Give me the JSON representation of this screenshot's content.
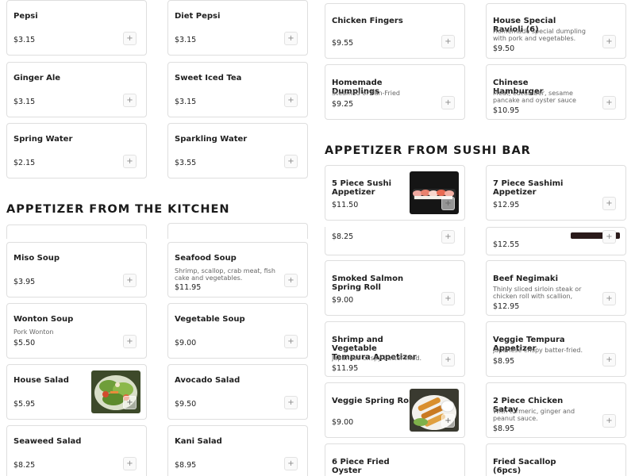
{
  "left": {
    "drinks": [
      {
        "name": "Pepsi",
        "price": "$3.15"
      },
      {
        "name": "Diet Pepsi",
        "price": "$3.15"
      },
      {
        "name": "Ginger Ale",
        "price": "$3.15"
      },
      {
        "name": "Sweet Iced Tea",
        "price": "$3.15"
      },
      {
        "name": "Spring Water",
        "price": "$2.15"
      },
      {
        "name": "Sparkling Water",
        "price": "$3.55"
      }
    ],
    "kitchen_title": "APPETIZER FROM THE KITCHEN",
    "kitchen": [
      {
        "name": "Miso Soup",
        "price": "$3.95"
      },
      {
        "name": "Seafood Soup",
        "desc": "Shrimp, scallop, crab meat, fish cake and vegetables.",
        "price": "$11.95"
      },
      {
        "name": "Wonton Soup",
        "desc": "Pork Wonton",
        "price": "$5.50"
      },
      {
        "name": "Vegetable Soup",
        "price": "$9.00"
      },
      {
        "name": "House Salad",
        "price": "$5.95"
      },
      {
        "name": "Avocado Salad",
        "price": "$9.50"
      },
      {
        "name": "Seaweed Salad",
        "price": "$8.25"
      },
      {
        "name": "Kani Salad",
        "price": "$8.95"
      }
    ]
  },
  "right": {
    "top": [
      {
        "name": "Chicken Fingers",
        "price": "$9.55"
      },
      {
        "name": "House Special Ravioli (6)",
        "desc": "Homemade special dumpling with pork and vegetables. Choice of...",
        "price": "$9.50"
      },
      {
        "name": "Homemade Dumplings",
        "desc": "Steamed or Pan-Fried",
        "price": "$9.25"
      },
      {
        "name": "Chinese Hamburger",
        "desc": "Meat, cucumber, sesame pancake and oyster sauce",
        "price": "$10.95"
      }
    ],
    "sushi_title": "APPETIZER FROM SUSHI BAR",
    "sushi_first": [
      {
        "name": "5 Piece Sushi Appetizer",
        "price": "$11.50"
      },
      {
        "name": "7 Piece Sashimi Appetizer",
        "price": "$12.95"
      }
    ],
    "partial_left_price": "$8.25",
    "partial_right_price": "$12.55",
    "sushi_rest": [
      {
        "name": "Smoked Salmon Spring Roll",
        "price": "$9.00"
      },
      {
        "name": "Beef Negimaki",
        "desc": "Thinly sliced sirloin steak or chicken roll with scallion, broiled in teriyak...",
        "price": "$12.95"
      },
      {
        "name": "Shrimp and Vegetable Tempura Appetizer",
        "desc": "Japanese crispy batter-fried.",
        "price": "$11.95"
      },
      {
        "name": "Veggie Tempura Appetizer",
        "desc": "Japanese crispy batter-fried.",
        "price": "$8.95"
      },
      {
        "name": "Veggie Spring Roll",
        "price": "$9.00"
      },
      {
        "name": "2 Piece Chicken Satay",
        "desc": "With turmeric, ginger and peanut sauce.",
        "price": "$8.95"
      },
      {
        "name": "6 Piece Fried Oyster"
      },
      {
        "name": "Fried Sacallop (6pcs)"
      }
    ]
  },
  "add_symbol": "+",
  "icons": {
    "add": "plus-icon"
  }
}
